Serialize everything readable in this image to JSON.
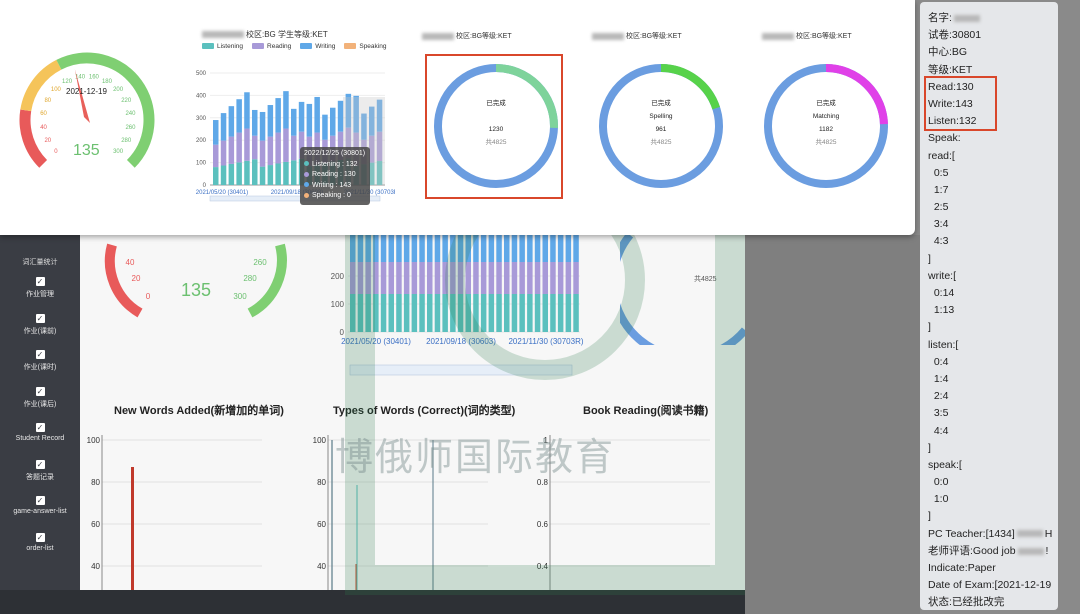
{
  "sidebar": {
    "header": "词汇量统计",
    "items": [
      {
        "label": "作业管理"
      },
      {
        "label": "作业(课前)"
      },
      {
        "label": "作业(课时)"
      },
      {
        "label": "作业(课后)"
      },
      {
        "label": "Student Record"
      },
      {
        "label": "答题记录"
      },
      {
        "label": "game-answer-list"
      },
      {
        "label": "order-list"
      }
    ]
  },
  "gauge": {
    "date": "2021-12-19",
    "value": "135",
    "value_fraction": 0.45,
    "ticks": [
      "0",
      "20",
      "40",
      "60",
      "80",
      "100",
      "120",
      "140",
      "160",
      "180",
      "200",
      "220",
      "240",
      "260",
      "280",
      "300"
    ]
  },
  "bg_gauge": {
    "value": "135",
    "ticks": [
      "0",
      "20",
      "40",
      "260",
      "280",
      "300"
    ]
  },
  "bar_chart": {
    "title_suffix": "校区:BG 学生等级:KET",
    "legend": [
      {
        "name": "Listening",
        "color": "#5bc0be"
      },
      {
        "name": "Reading",
        "color": "#a89ad8"
      },
      {
        "name": "Writing",
        "color": "#5fa8e8"
      },
      {
        "name": "Speaking",
        "color": "#f2b27a"
      }
    ],
    "y_ticks": [
      "500",
      "400",
      "300",
      "200",
      "100",
      "0"
    ],
    "x_ticks": [
      "2021/05/20 (30401)",
      "2021/09/18 (30603)",
      "2021/11/30 (30703R)"
    ]
  },
  "bg_bar_chart": {
    "y_ticks": [
      "200",
      "100",
      "0"
    ],
    "x_ticks": [
      "2021/05/20 (30401)",
      "2021/09/18 (30603)",
      "2021/11/30 (30703R)"
    ]
  },
  "tooltip": {
    "title": "2022/12/25 (30801)",
    "rows": [
      {
        "label": "Listening : 132",
        "color": "#5bc0be"
      },
      {
        "label": "Reading : 130",
        "color": "#a89ad8"
      },
      {
        "label": "Writing : 143",
        "color": "#5fa8e8"
      },
      {
        "label": "Speaking : 0",
        "color": "#f2b27a"
      }
    ]
  },
  "donuts": [
    {
      "title": "校区:BG等级:KET",
      "status": "已完成",
      "subject": "",
      "value": "1230",
      "total": "共4825",
      "fraction": 0.255,
      "color": "#7ed39b"
    },
    {
      "title": "校区:BG等级:KET",
      "status": "已完成",
      "subject": "Spelling",
      "value": "961",
      "total": "共4825",
      "fraction": 0.2,
      "color": "#57d24a"
    },
    {
      "title": "校区:BG等级:KET",
      "status": "已完成",
      "subject": "Matching",
      "value": "1182",
      "total": "共4825",
      "fraction": 0.245,
      "color": "#e040e8"
    }
  ],
  "bg_donut_total": "共4825",
  "bottom_charts": {
    "new_words": {
      "title": "New Words Added(新增加的单词)",
      "y_ticks": [
        "100",
        "80",
        "60",
        "40"
      ]
    },
    "types": {
      "title": "Types of Words (Correct)(词的类型)",
      "y_ticks": [
        "100",
        "80",
        "60",
        "40"
      ]
    },
    "reading": {
      "title": "Book Reading(阅读书籍)",
      "y_ticks": [
        "1",
        "0.8",
        "0.6",
        "0.4"
      ]
    }
  },
  "watermark_text": "博俄师国际教育",
  "info": {
    "lines": [
      "名字:",
      "试卷:30801",
      "中心:BG",
      "等级:KET",
      "Read:130",
      "Write:143",
      "Listen:132",
      "Speak:",
      "read:[",
      "  0:5",
      "  1:7",
      "  2:5",
      "  3:4",
      "  4:3",
      "]",
      "write:[",
      "  0:14",
      "  1:13",
      "]",
      "listen:[",
      "  0:4",
      "  1:4",
      "  2:4",
      "  3:5",
      "  4:4",
      "]",
      "speak:[",
      "  0:0",
      "  1:0",
      "]",
      "PC Teacher:[1434]",
      "老师评语:Good job",
      "Indicate:Paper",
      "Date of Exam:[2021-12-19",
      "状态:已经批改完"
    ],
    "pc_teacher_suffix": "H",
    "comment_suffix": "!"
  },
  "colors": {
    "accent_red": "#d9472b",
    "sidebar": "#3a3d44"
  }
}
